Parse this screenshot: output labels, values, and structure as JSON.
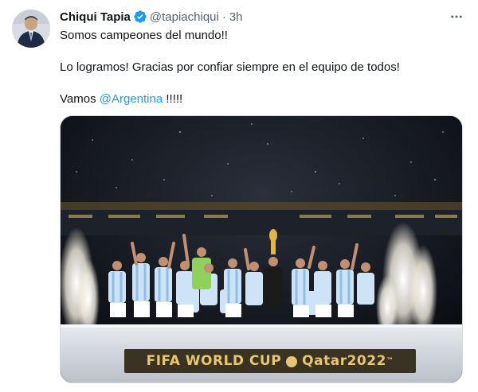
{
  "tweet": {
    "author_name": "Chiqui Tapia",
    "verified": true,
    "handle": "@tapiachiqui",
    "separator": "·",
    "time": "3h",
    "more_icon": "more-horizontal-icon",
    "text": {
      "line1": "Somos campeones del mundo!!",
      "line2": "Lo logramos! Gracias por confiar siempre en el equipo de todos!",
      "line3_prefix": "Vamos",
      "mention": "@Argentina",
      "line3_suffix": " !!!!!"
    },
    "media": {
      "banner_left": "FIFA WORLD CUP",
      "banner_right": "Qatar2022",
      "banner_tm": "™"
    }
  },
  "colors": {
    "accent": "#1d9bf0",
    "text": "#0f1419",
    "muted": "#536471",
    "banner_gold": "#e9c671",
    "stadium_dark": "#0b0d12"
  }
}
